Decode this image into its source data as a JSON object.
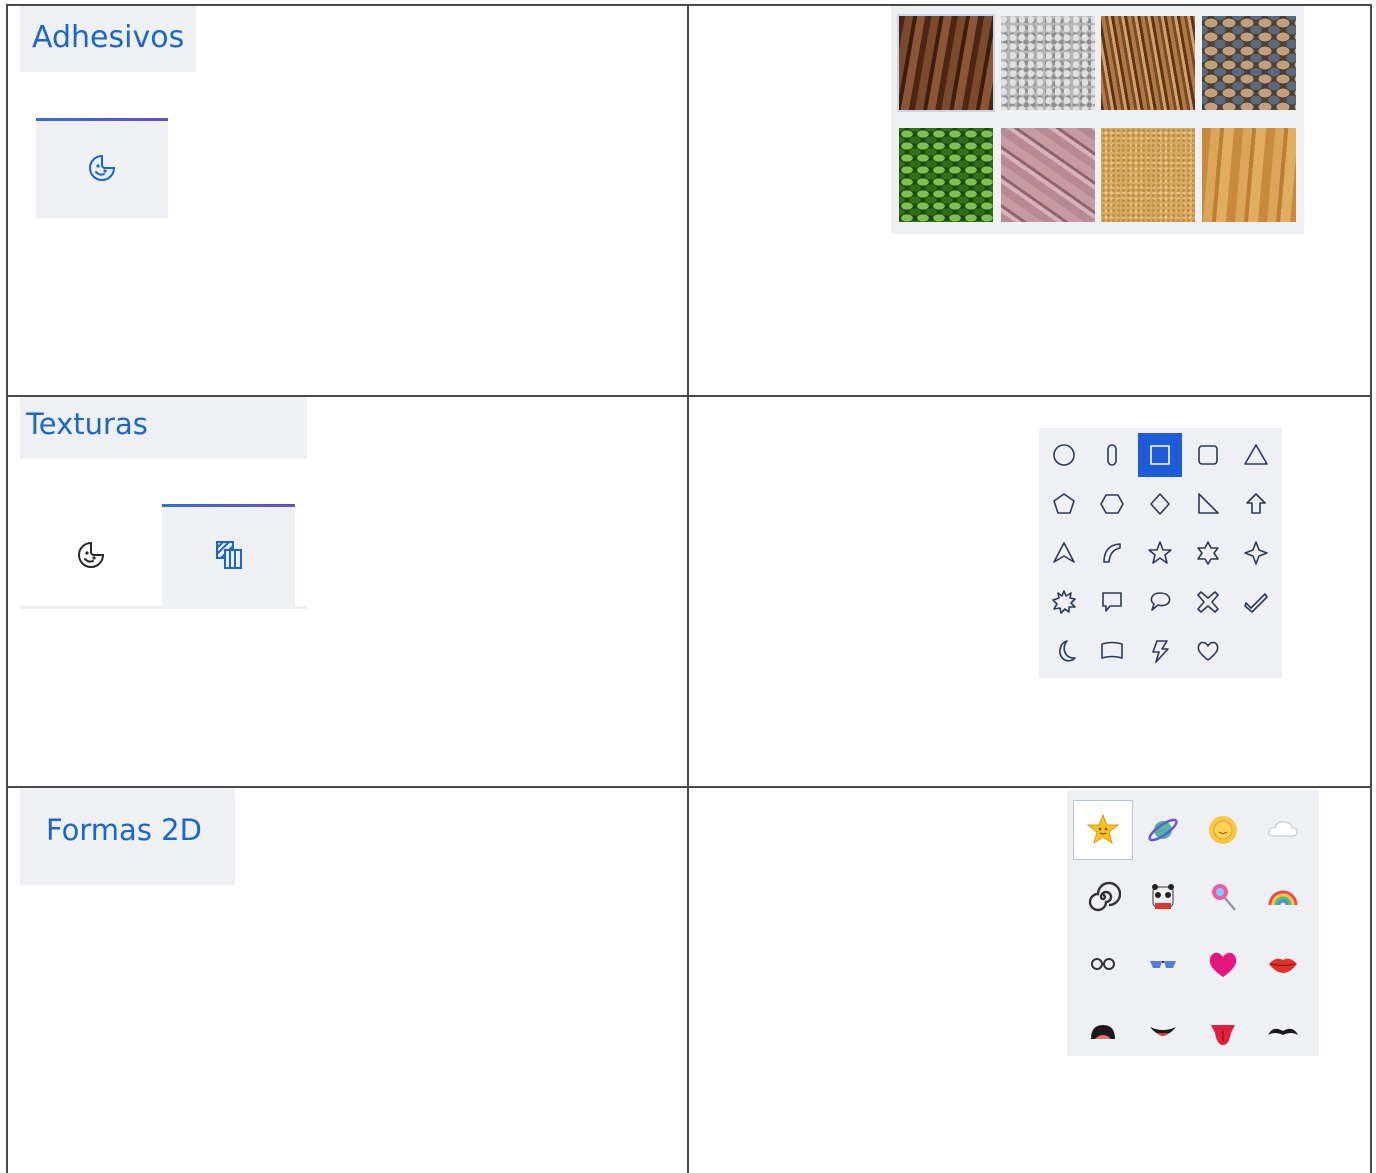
{
  "sections": {
    "stickers_title": "Adhesivos",
    "textures_title": "Texturas",
    "shapes_title": "Formas 2D"
  },
  "icons": {
    "stickers_tab": "sticker-icon",
    "textures_tab": "texture-icon"
  },
  "textures": [
    {
      "name": "bark",
      "color": "#6b3a22"
    },
    {
      "name": "gravel",
      "color": "#b9b9b9"
    },
    {
      "name": "hair",
      "color": "#8a5a2e"
    },
    {
      "name": "pebbles",
      "color": "#7f7568"
    },
    {
      "name": "leaves",
      "color": "#3b7d22"
    },
    {
      "name": "marble",
      "color": "#b98a95"
    },
    {
      "name": "sand",
      "color": "#d6a95e"
    },
    {
      "name": "wood",
      "color": "#d49a45"
    }
  ],
  "shapes": [
    "circle",
    "capsule",
    "square",
    "rounded-square",
    "triangle",
    "pentagon",
    "hexagon",
    "diamond",
    "right-triangle",
    "arrow-up",
    "triangle-outline",
    "curve",
    "star5",
    "star6",
    "star4",
    "burst",
    "callout-rect",
    "callout-oval",
    "x-shape",
    "check",
    "moon",
    "banner",
    "lightning",
    "heart"
  ],
  "stickers": [
    "star-face",
    "planet",
    "sun-face",
    "cloud",
    "spiral",
    "panda",
    "lollipop",
    "rainbow",
    "glasses",
    "sunglasses",
    "heart",
    "lips",
    "mouth-open",
    "mouth-smile",
    "tongue",
    "mustache"
  ],
  "colors": {
    "accent": "#1b66c9",
    "panel": "#eef0f3",
    "selected_shape": "#1e5bd6",
    "shape_stroke": "#2b3a57"
  }
}
